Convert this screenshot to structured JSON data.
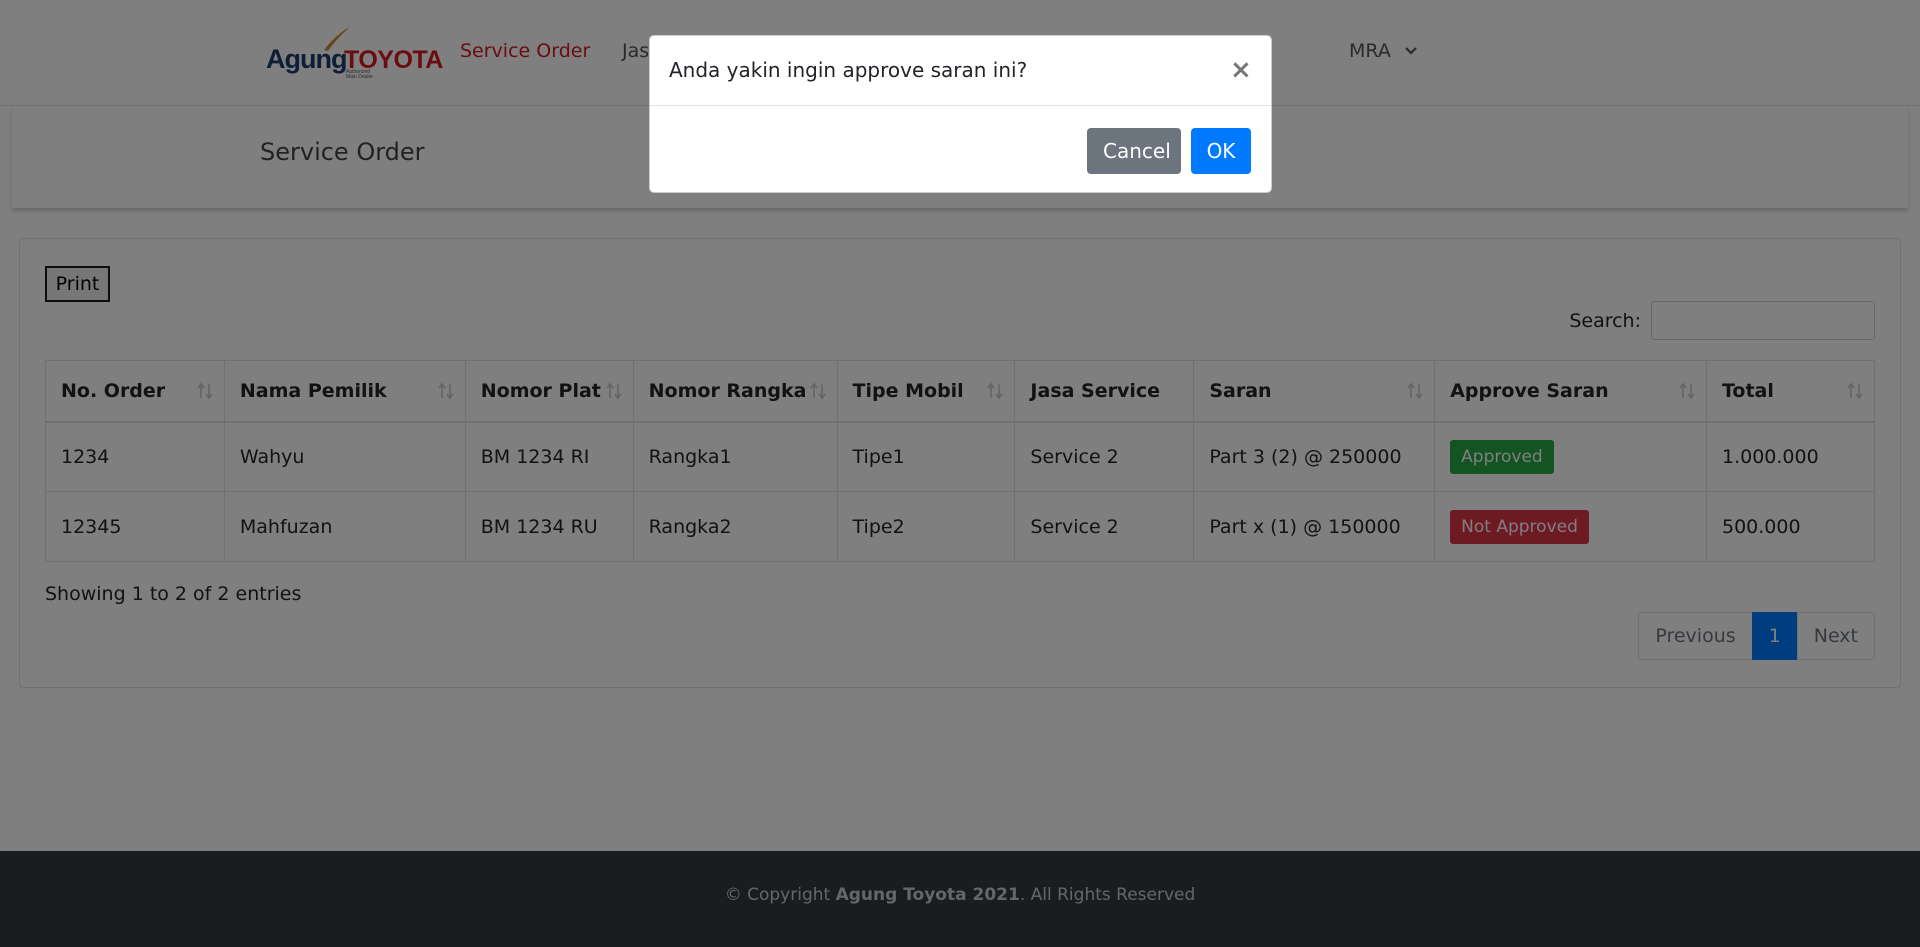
{
  "header": {
    "logo": {
      "agung": "Agung",
      "toyota": "TOYOTA",
      "tagline_1": "Authorized",
      "tagline_2": "Main Dealer"
    },
    "nav": [
      {
        "label": "Service Order",
        "active": true
      },
      {
        "label": "Jasa Service",
        "active": false
      }
    ],
    "user_menu": {
      "label": "MRA",
      "icon": "chevron-down-icon"
    }
  },
  "page": {
    "title": "Service Order"
  },
  "toolbar": {
    "print_label": "Print"
  },
  "search": {
    "label": "Search:",
    "value": "",
    "placeholder": ""
  },
  "table": {
    "columns": [
      "No. Order",
      "Nama Pemilik",
      "Nomor Plat",
      "Nomor Rangka",
      "Tipe Mobil",
      "Jasa Service",
      "Saran",
      "Approve Saran",
      "Total"
    ],
    "rows": [
      {
        "no_order": "1234",
        "nama_pemilik": "Wahyu",
        "nomor_plat": "BM 1234 RI",
        "nomor_rangka": "Rangka1",
        "tipe_mobil": "Tipe1",
        "jasa_service": "Service 2",
        "saran": "Part 3 (2) @ 250000",
        "approve_saran": "Approved",
        "total": "1.000.000"
      },
      {
        "no_order": "12345",
        "nama_pemilik": "Mahfuzan",
        "nomor_plat": "BM 1234 RU",
        "nomor_rangka": "Rangka2",
        "tipe_mobil": "Tipe2",
        "jasa_service": "Service 2",
        "saran": "Part x (1) @ 150000",
        "approve_saran": "Not Approved",
        "total": "500.000"
      }
    ]
  },
  "pagination": {
    "info": "Showing 1 to 2 of 2 entries",
    "previous": "Previous",
    "current": "1",
    "next": "Next"
  },
  "footer": {
    "prefix": "© Copyright ",
    "brand": "Agung Toyota 2021",
    "suffix": ". All Rights Reserved"
  },
  "modal": {
    "title": "Anda yakin ingin approve saran ini?",
    "close_label": "×",
    "cancel_label": "Cancel",
    "ok_label": "OK"
  },
  "colors": {
    "brand_red": "#d71921",
    "brand_navy": "#1f3a6e",
    "primary": "#007bff",
    "secondary": "#6c757d",
    "success": "#28a745",
    "danger": "#dc3545",
    "footer_bg": "#343a40",
    "backdrop": "rgba(0,0,0,0.5)"
  }
}
